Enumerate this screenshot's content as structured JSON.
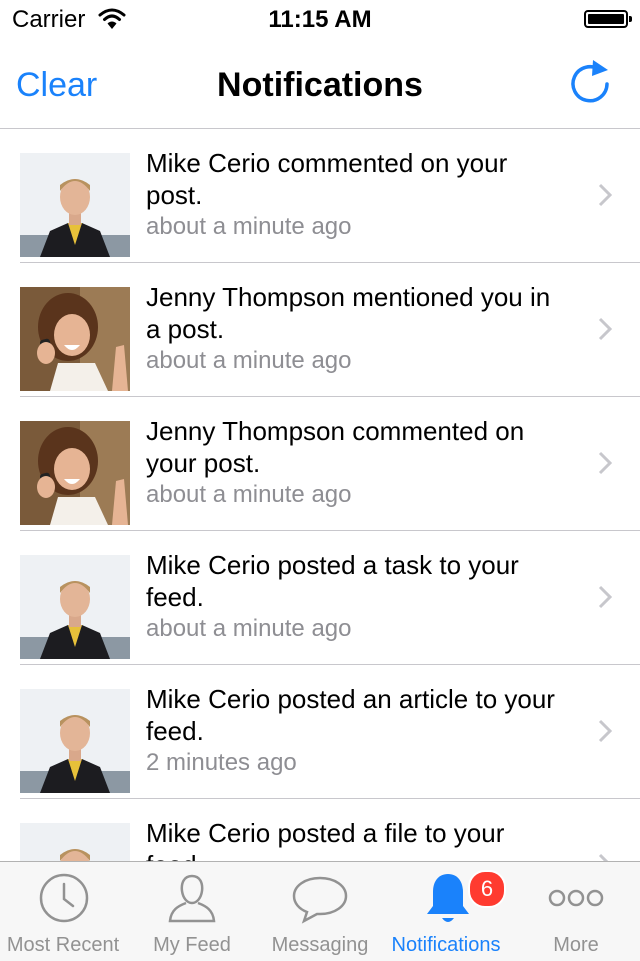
{
  "status_bar": {
    "carrier": "Carrier",
    "time": "11:15 AM"
  },
  "nav": {
    "left_button": "Clear",
    "title": "Notifications",
    "right_icon": "refresh-icon"
  },
  "notifications": [
    {
      "message": "Mike Cerio commented on your post.",
      "time": "about a minute ago",
      "avatar": "mike-avatar"
    },
    {
      "message": "Jenny Thompson mentioned you in a post.",
      "time": "about a minute ago",
      "avatar": "jenny-avatar"
    },
    {
      "message": "Jenny Thompson commented on your post.",
      "time": "about a minute ago",
      "avatar": "jenny-avatar"
    },
    {
      "message": "Mike Cerio posted a task to your feed.",
      "time": "about a minute ago",
      "avatar": "mike-avatar"
    },
    {
      "message": "Mike Cerio posted an article to your feed.",
      "time": "2 minutes ago",
      "avatar": "mike-avatar"
    },
    {
      "message": "Mike Cerio posted a file to your feed.",
      "time": "",
      "avatar": "mike-avatar"
    }
  ],
  "tabs": [
    {
      "label": "Most Recent",
      "icon": "clock-icon"
    },
    {
      "label": "My Feed",
      "icon": "person-icon"
    },
    {
      "label": "Messaging",
      "icon": "speech-bubble-icon"
    },
    {
      "label": "Notifications",
      "icon": "bell-icon",
      "badge": "6"
    },
    {
      "label": "More",
      "icon": "more-dots-icon"
    }
  ],
  "colors": {
    "accent": "#1a82fb",
    "badge": "#ff3b30",
    "secondary_text": "#8e8e93"
  }
}
